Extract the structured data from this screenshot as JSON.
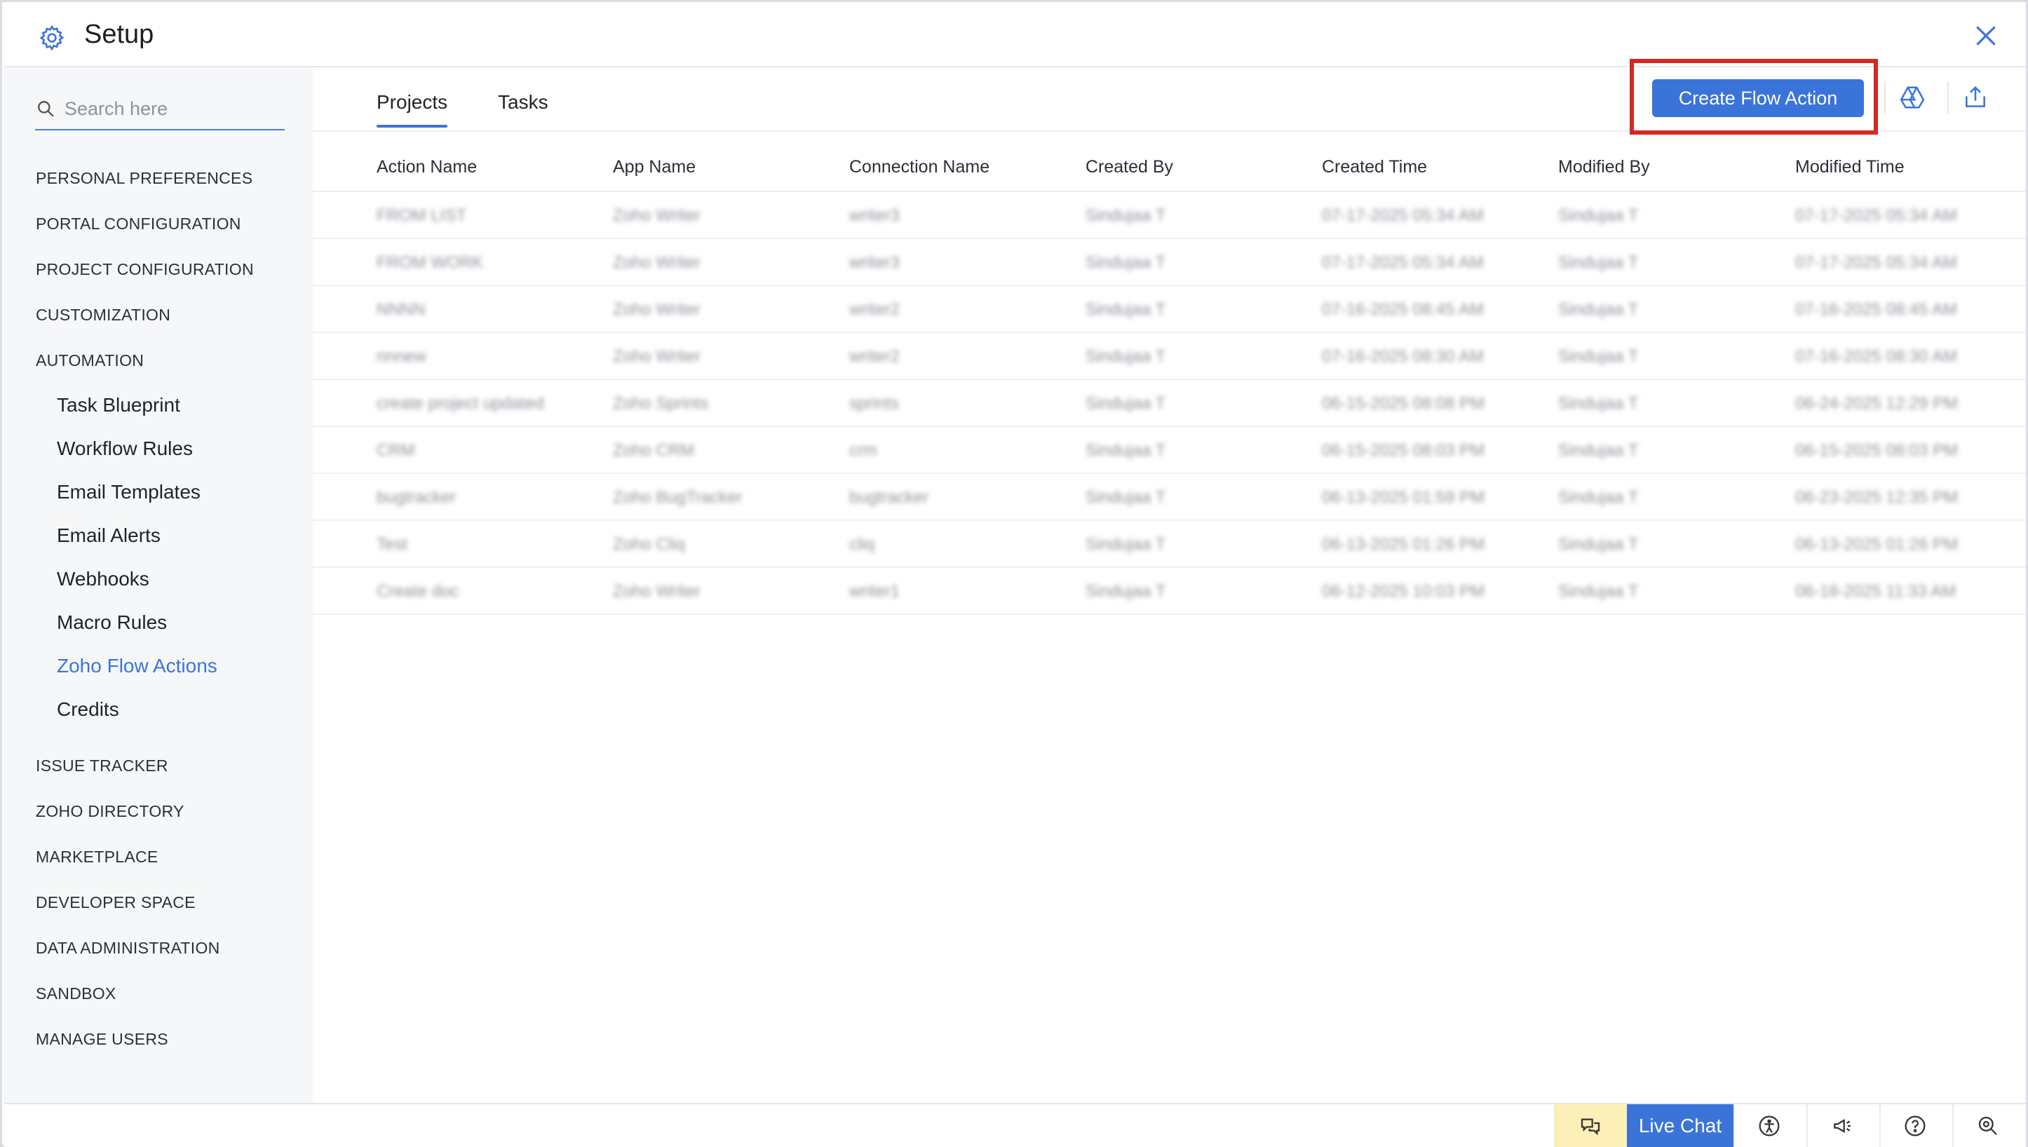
{
  "header": {
    "title": "Setup",
    "gear_icon": "gear-icon",
    "close_icon": "close-icon"
  },
  "sidebar": {
    "search_placeholder": "Search here",
    "sections": [
      "PERSONAL PREFERENCES",
      "PORTAL CONFIGURATION",
      "PROJECT CONFIGURATION",
      "CUSTOMIZATION",
      "AUTOMATION"
    ],
    "automation_items": [
      "Task Blueprint",
      "Workflow Rules",
      "Email Templates",
      "Email Alerts",
      "Webhooks",
      "Macro Rules",
      "Zoho Flow Actions",
      "Credits"
    ],
    "active_item": "Zoho Flow Actions",
    "sections_after": [
      "ISSUE TRACKER",
      "ZOHO DIRECTORY",
      "MARKETPLACE",
      "DEVELOPER SPACE",
      "DATA ADMINISTRATION",
      "SANDBOX",
      "MANAGE USERS"
    ]
  },
  "main": {
    "tabs": [
      {
        "label": "Projects",
        "active": true
      },
      {
        "label": "Tasks",
        "active": false
      }
    ],
    "create_button": "Create Flow Action",
    "columns": [
      "Action Name",
      "App Name",
      "Connection Name",
      "Created By",
      "Created Time",
      "Modified By",
      "Modified Time"
    ],
    "rows": [
      [
        "FROM LIST",
        "Zoho Writer",
        "writer3",
        "Sindujaa T",
        "07-17-2025 05:34 AM",
        "Sindujaa T",
        "07-17-2025 05:34 AM"
      ],
      [
        "FROM WORK",
        "Zoho Writer",
        "writer3",
        "Sindujaa T",
        "07-17-2025 05:34 AM",
        "Sindujaa T",
        "07-17-2025 05:34 AM"
      ],
      [
        "NNNN",
        "Zoho Writer",
        "writer2",
        "Sindujaa T",
        "07-16-2025 08:45 AM",
        "Sindujaa T",
        "07-16-2025 08:45 AM"
      ],
      [
        "nnnew",
        "Zoho Writer",
        "writer2",
        "Sindujaa T",
        "07-16-2025 08:30 AM",
        "Sindujaa T",
        "07-16-2025 08:30 AM"
      ],
      [
        "create project updated",
        "Zoho Sprints",
        "sprints",
        "Sindujaa T",
        "06-15-2025 08:08 PM",
        "Sindujaa T",
        "06-24-2025 12:29 PM"
      ],
      [
        "CRM",
        "Zoho CRM",
        "crm",
        "Sindujaa T",
        "06-15-2025 08:03 PM",
        "Sindujaa T",
        "06-15-2025 08:03 PM"
      ],
      [
        "bugtracker",
        "Zoho BugTracker",
        "bugtracker",
        "Sindujaa T",
        "06-13-2025 01:59 PM",
        "Sindujaa T",
        "06-23-2025 12:35 PM"
      ],
      [
        "Test",
        "Zoho Cliq",
        "cliq",
        "Sindujaa T",
        "06-13-2025 01:26 PM",
        "Sindujaa T",
        "06-13-2025 01:26 PM"
      ],
      [
        "Create doc",
        "Zoho Writer",
        "writer1",
        "Sindujaa T",
        "06-12-2025 10:03 PM",
        "Sindujaa T",
        "06-18-2025 11:33 AM"
      ]
    ]
  },
  "bottom_bar": {
    "live_chat": "Live Chat"
  },
  "colors": {
    "accent": "#3b74d9",
    "highlight": "#d6281e",
    "chat_bg": "#fdefb8"
  }
}
